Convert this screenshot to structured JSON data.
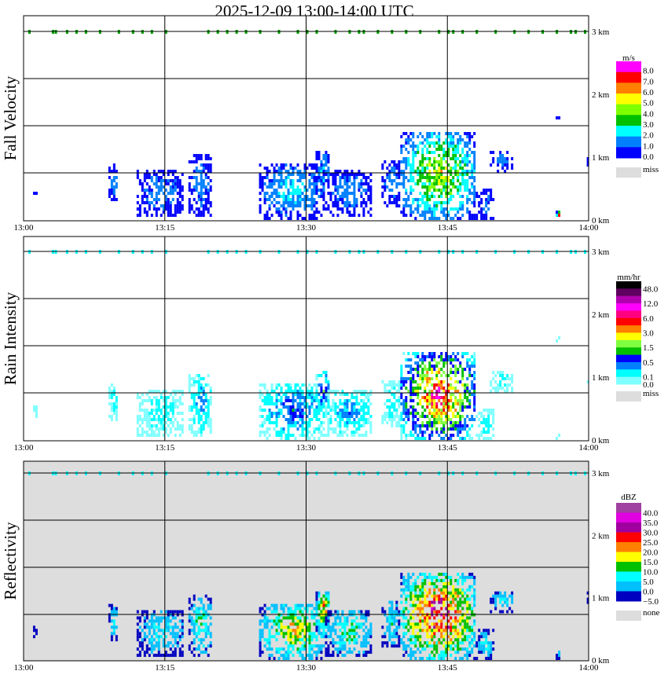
{
  "title": "2025-12-09   13:00-14:00 UTC",
  "chart_data": [
    {
      "type": "heatmap",
      "ylabel": "Fall Velocity",
      "unit": "m/s",
      "x_ticks": [
        "13:00",
        "13:15",
        "13:30",
        "13:45",
        "14:00"
      ],
      "xlim_minutes": [
        0,
        60
      ],
      "y_ticks": [
        "0 km",
        "1 km",
        "2 km",
        "3 km"
      ],
      "ylim_km": [
        0,
        3
      ],
      "background": "#ffffff",
      "clutter_color": "#00a000",
      "legend_labels": [
        "8.0",
        "7.0",
        "6.0",
        "5.0",
        "4.0",
        "3.0",
        "2.0",
        "1.0",
        "0.0"
      ],
      "legend_colors": [
        "#ff00ff",
        "#ff0000",
        "#ff8000",
        "#ffff00",
        "#80ff00",
        "#00c000",
        "#00ffff",
        "#0080ff",
        "#0000ff"
      ],
      "missing_label": "miss",
      "missing_color": "#dddddd",
      "grid": true
    },
    {
      "type": "heatmap",
      "ylabel": "Rain Intensity",
      "unit": "mm/hr",
      "x_ticks": [
        "13:00",
        "13:15",
        "13:30",
        "13:45",
        "14:00"
      ],
      "xlim_minutes": [
        0,
        60
      ],
      "y_ticks": [
        "0 km",
        "1 km",
        "2 km",
        "3 km"
      ],
      "ylim_km": [
        0,
        3
      ],
      "background": "#ffffff",
      "clutter_color": "#00ffff",
      "legend_labels": [
        "48.0",
        "12.0",
        "6.0",
        "3.0",
        "1.5",
        "0.5",
        "0.1",
        "0.0"
      ],
      "legend_colors": [
        "#000000",
        "#600060",
        "#b000b0",
        "#ff00ff",
        "#ff0080",
        "#ff0000",
        "#ff8000",
        "#ffff00",
        "#80ff40",
        "#00c000",
        "#0000ff",
        "#0080ff",
        "#00ffff",
        "#80ffff"
      ],
      "missing_label": "miss",
      "missing_color": "#dddddd",
      "grid": true
    },
    {
      "type": "heatmap",
      "ylabel": "Reflectivity",
      "unit": "dBZ",
      "x_ticks": [
        "13:00",
        "13:15",
        "13:30",
        "13:45",
        "14:00"
      ],
      "xlim_minutes": [
        0,
        60
      ],
      "y_ticks": [
        "0 km",
        "1 km",
        "2 km",
        "3 km"
      ],
      "ylim_km": [
        0,
        3
      ],
      "background": "#dddddd",
      "clutter_color": "#00ffff",
      "legend_labels": [
        "40.0",
        "35.0",
        "30.0",
        "25.0",
        "20.0",
        "15.0",
        "10.0",
        "5.0",
        "0.0",
        "−5.0"
      ],
      "legend_colors": [
        "#a040a0",
        "#e000e0",
        "#a000a0",
        "#ff0000",
        "#ff8000",
        "#ffff00",
        "#00c000",
        "#00ffff",
        "#00c0ff",
        "#0000c0"
      ],
      "missing_label": "none",
      "missing_color": "#dddddd",
      "grid": true
    }
  ],
  "echo_regions": [
    {
      "t": [
        1,
        1.3
      ],
      "h": [
        0.35,
        0.5
      ],
      "peak": [
        1,
        1,
        2
      ]
    },
    {
      "t": [
        9,
        10
      ],
      "h": [
        0.3,
        0.9
      ],
      "peak": [
        2,
        2,
        3
      ]
    },
    {
      "t": [
        12,
        17
      ],
      "h": [
        0.05,
        0.8
      ],
      "peak": [
        2,
        2,
        3
      ]
    },
    {
      "t": [
        17.5,
        20
      ],
      "h": [
        0.05,
        1.05
      ],
      "peak": [
        2,
        3,
        4
      ]
    },
    {
      "t": [
        25,
        32
      ],
      "h": [
        0.0,
        0.9
      ],
      "peak": [
        3,
        4,
        6
      ]
    },
    {
      "t": [
        31,
        32.5
      ],
      "h": [
        0.4,
        1.1
      ],
      "peak": [
        3,
        5,
        7
      ]
    },
    {
      "t": [
        32,
        37
      ],
      "h": [
        0.05,
        0.8
      ],
      "peak": [
        2,
        3,
        4
      ]
    },
    {
      "t": [
        38,
        40
      ],
      "h": [
        0.2,
        0.95
      ],
      "peak": [
        2,
        2,
        3
      ]
    },
    {
      "t": [
        40,
        48
      ],
      "h": [
        0.0,
        1.4
      ],
      "peak": [
        6,
        11,
        9
      ]
    },
    {
      "t": [
        48,
        50
      ],
      "h": [
        0.0,
        0.45
      ],
      "peak": [
        2,
        2,
        3
      ]
    },
    {
      "t": [
        49.5,
        52
      ],
      "h": [
        0.75,
        1.1
      ],
      "peak": [
        2,
        2,
        3
      ]
    },
    {
      "t": [
        56.5,
        57
      ],
      "h": [
        1.55,
        1.62
      ],
      "peak": [
        1,
        1,
        2
      ]
    },
    {
      "t": [
        56.5,
        57
      ],
      "h": [
        0.0,
        0.12
      ],
      "peak": [
        8,
        1,
        2
      ]
    },
    {
      "t": [
        59.8,
        60
      ],
      "h": [
        0.85,
        1.1
      ],
      "peak": [
        1,
        1,
        2
      ]
    }
  ],
  "clutter_3km_minutes": [
    0.5,
    3,
    3.3,
    4.5,
    5.5,
    6.5,
    8,
    10,
    11.5,
    12.5,
    13.5,
    15,
    19.5,
    20.5,
    21.5,
    22.5,
    23.5,
    25,
    27,
    29,
    30,
    31,
    33,
    34.5,
    35.5,
    36,
    37.5,
    39,
    40.5,
    42,
    44,
    45,
    45.5,
    46.5,
    48,
    50,
    52,
    53.5,
    55,
    56.5,
    58,
    58.5,
    59.5
  ]
}
